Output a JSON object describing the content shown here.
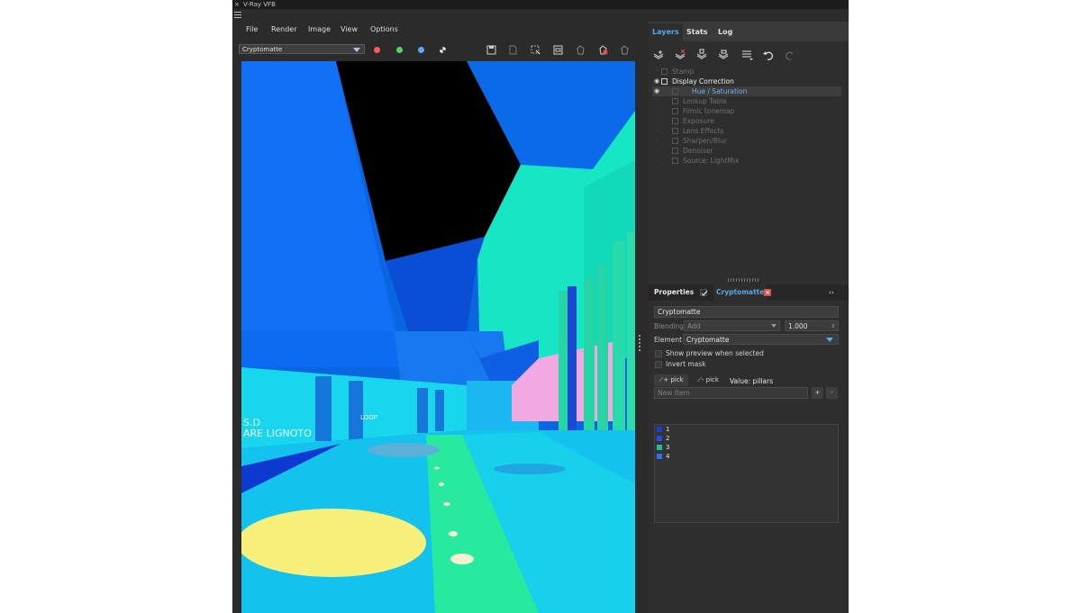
{
  "window": {
    "close_glyph": "×",
    "title": "V-Ray VFB"
  },
  "menu": [
    "File",
    "Render",
    "Image",
    "View",
    "Options"
  ],
  "toolbar": {
    "channel_select": "Cryptomatte",
    "channel_dots": [
      {
        "name": "red-channel-dot",
        "color": "#ff5a5a"
      },
      {
        "name": "green-channel-dot",
        "color": "#55d35a"
      },
      {
        "name": "blue-channel-dot",
        "color": "#5aaaf2"
      },
      {
        "name": "alpha-channel-dot",
        "color": "#e0e0e0"
      }
    ],
    "icons": [
      "save-icon",
      "clear-image-icon",
      "region-render-icon",
      "track-mouse-icon",
      "render-icon",
      "stop-render-icon",
      "interactive-render-icon"
    ]
  },
  "tabs": {
    "layers": "Layers",
    "stats": "Stats",
    "log": "Log"
  },
  "layer_tools": [
    "create-layer-icon",
    "delete-layer-icon",
    "save-layers-icon",
    "load-layers-icon",
    "layer-presets-icon",
    "undo-icon",
    "redo-icon"
  ],
  "layers": [
    {
      "label": "Stamp",
      "indent": 1,
      "state": "dim"
    },
    {
      "label": "Display Correction",
      "indent": 0,
      "state": "bright"
    },
    {
      "label": "Hue / Saturation",
      "indent": 2,
      "state": "selected"
    },
    {
      "label": "Lookup Table",
      "indent": 2,
      "state": "dim"
    },
    {
      "label": "Filmic tonemap",
      "indent": 2,
      "state": "dim"
    },
    {
      "label": "Exposure",
      "indent": 2,
      "state": "dim"
    },
    {
      "label": "Lens Effects",
      "indent": 2,
      "state": "dim"
    },
    {
      "label": "Sharpen/Blur",
      "indent": 2,
      "state": "dim"
    },
    {
      "label": "Denoiser",
      "indent": 2,
      "state": "dim"
    },
    {
      "label": "Source: LightMix",
      "indent": 2,
      "state": "dim"
    }
  ],
  "properties": {
    "tab_label": "Properties",
    "layer_name": "Cryptomatte",
    "name_field": "Cryptomatte",
    "blending_label": "Blending",
    "blending_value": "Add",
    "opacity_value": "1.000",
    "element_label": "Element",
    "element_value": "Cryptomatte",
    "show_preview": "Show preview when selected",
    "invert_mask": "Invert mask",
    "add_pick": "+ pick",
    "remove_pick": "- pick",
    "value_label": "Value: pillars",
    "new_item_placeholder": "New Item",
    "plus": "+",
    "minus": "-",
    "items": [
      {
        "label": "1",
        "color": "#1a3fd6"
      },
      {
        "label": "2",
        "color": "#1e4fe0"
      },
      {
        "label": "3",
        "color": "#19c49a"
      },
      {
        "label": "4",
        "color": "#2f6fe8"
      }
    ]
  }
}
